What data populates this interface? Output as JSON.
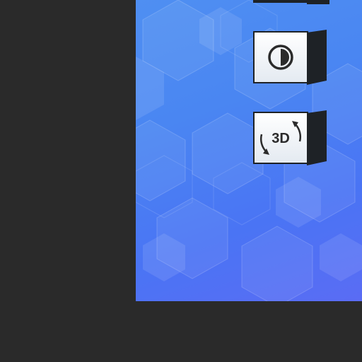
{
  "toolbar": {
    "contrast_button": {
      "icon": "contrast-icon"
    },
    "view3d_button": {
      "icon": "rotate-3d-icon",
      "label": "3D"
    }
  },
  "colors": {
    "background": "#2a2a2a",
    "viewport_gradient": [
      "#4f8ff2",
      "#5a6cf4"
    ],
    "button_face": "#f2f5f8",
    "button_edge": "#1e2226"
  }
}
